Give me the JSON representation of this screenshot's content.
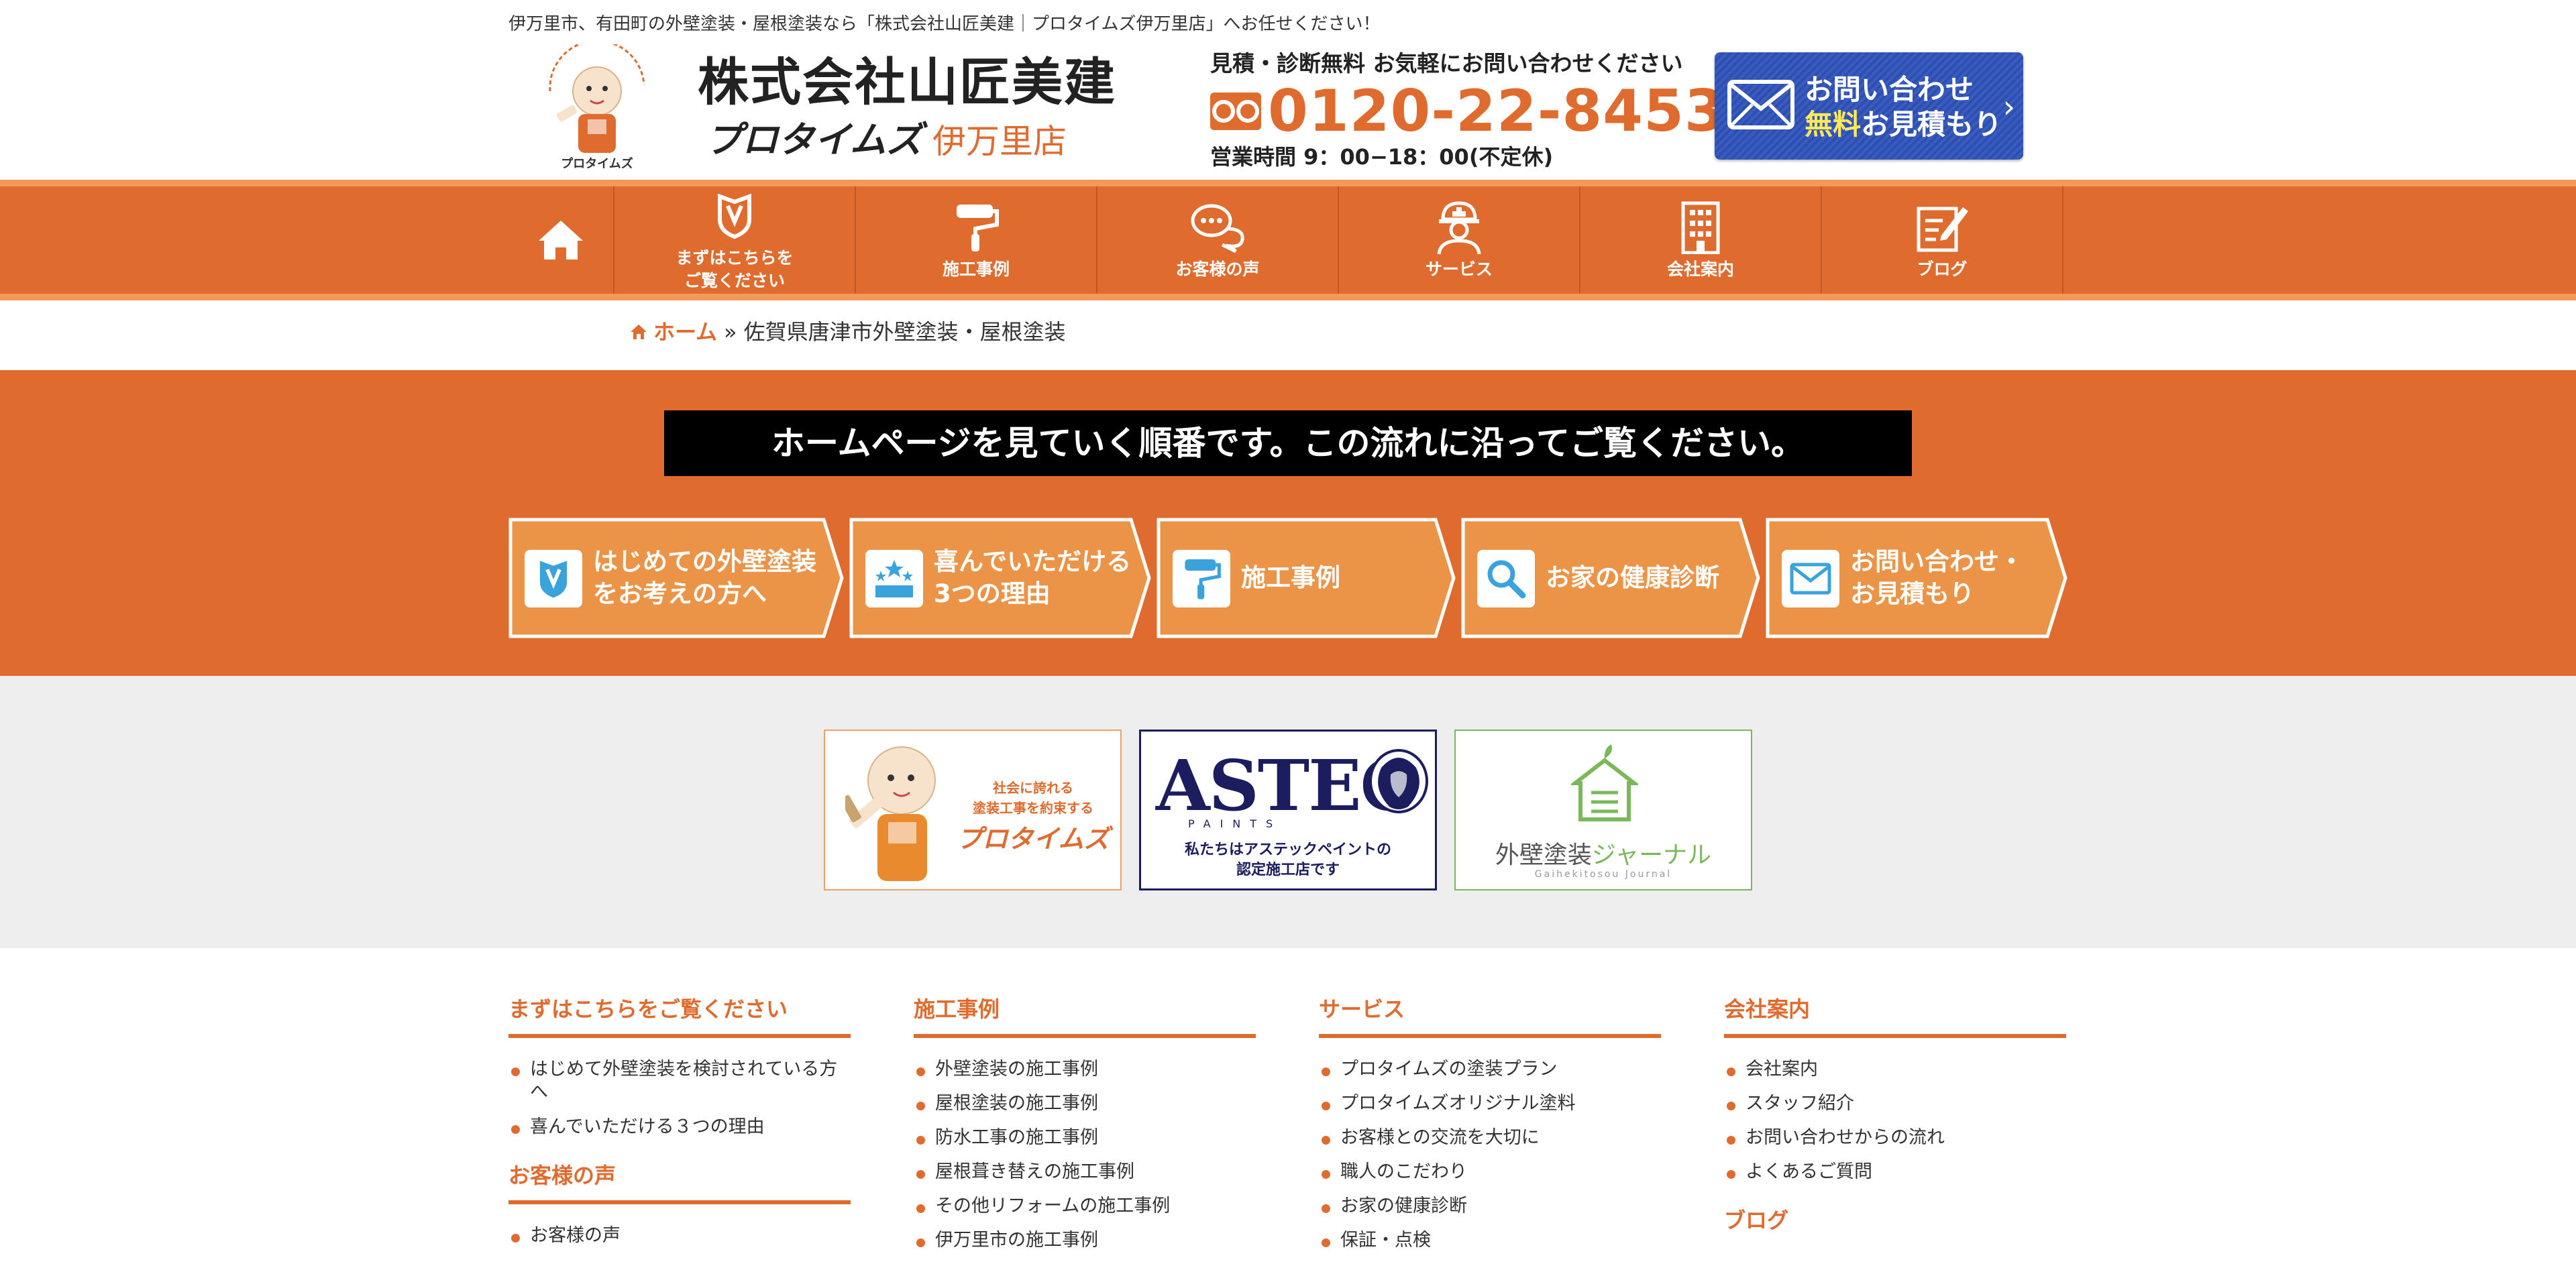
{
  "header": {
    "tagline": "伊万里市、有田町の外壁塗装・屋根塗装なら「株式会社山匠美建｜プロタイムズ伊万里店」へお任せください！",
    "company_name": "株式会社山匠美建",
    "brand": "プロタイムズ",
    "branch": "伊万里店",
    "contact_lead": "見積・診断無料 お気軽にお問い合わせください",
    "phone": "0120-22-8453",
    "hours": "営業時間 9：00−18：00(不定休)",
    "cta_line1": "お問い合わせ",
    "cta_free": "無料",
    "cta_line2": "お見積もり"
  },
  "nav": {
    "items": [
      {
        "label": "まずはこちらを\nご覧ください",
        "icon": "shield-check-icon"
      },
      {
        "label": "施工事例",
        "icon": "paint-roller-icon"
      },
      {
        "label": "お客様の声",
        "icon": "speech-bubbles-icon"
      },
      {
        "label": "サービス",
        "icon": "worker-icon"
      },
      {
        "label": "会社案内",
        "icon": "building-icon"
      },
      {
        "label": "ブログ",
        "icon": "pencil-note-icon"
      }
    ]
  },
  "breadcrumb": {
    "home": "ホーム",
    "separator": "»",
    "current": "佐賀県唐津市外壁塗装・屋根塗装"
  },
  "flow": {
    "title": "ホームページを見ていく順番です。この流れに沿ってご覧ください。",
    "steps": [
      {
        "label": "はじめての外壁塗装\nをお考えの方へ",
        "icon": "shield-check-icon"
      },
      {
        "label": "喜んでいただける\n3つの理由",
        "icon": "podium-stars-icon"
      },
      {
        "label": "施工事例",
        "icon": "paint-roller-icon"
      },
      {
        "label": "お家の健康診断",
        "icon": "magnifier-icon"
      },
      {
        "label": "お問い合わせ・\nお見積もり",
        "icon": "envelope-icon"
      }
    ]
  },
  "banners": {
    "protimes_text": "社会に誇れる\n塗装工事を約束する",
    "protimes_brand": "プロタイムズ",
    "astec_logo": "ASTEC",
    "astec_sub": "PAINTS",
    "astec_caption": "私たちはアステックペイントの\n認定施工店です",
    "journal_title_a": "外壁塗装",
    "journal_title_b": "ジャーナル",
    "journal_sub": "Gaihekitosou Journal"
  },
  "sitemap": {
    "col1_h": "まずはこちらをご覧ください",
    "col1_items": [
      "はじめて外壁塗装を検討されている方へ",
      "喜んでいただける３つの理由"
    ],
    "col1_h2": "お客様の声",
    "col1_items2": [
      "お客様の声"
    ],
    "col2_h": "施工事例",
    "col2_items": [
      "外壁塗装の施工事例",
      "屋根塗装の施工事例",
      "防水工事の施工事例",
      "屋根葺き替えの施工事例",
      "その他リフォームの施工事例",
      "伊万里市の施工事例"
    ],
    "col3_h": "サービス",
    "col3_items": [
      "プロタイムズの塗装プラン",
      "プロタイムズオリジナル塗料",
      "お客様との交流を大切に",
      "職人のこだわり",
      "お家の健康診断",
      "保証・点検"
    ],
    "col4_h": "会社案内",
    "col4_items": [
      "会社案内",
      "スタッフ紹介",
      "お問い合わせからの流れ",
      "よくあるご質問"
    ],
    "col4_h2": "ブログ"
  },
  "colors": {
    "accent": "#e06b2f",
    "accent_light": "#f29a5a",
    "step_fill": "#eb9448",
    "cta_blue": "#2d4fb0",
    "astec_navy": "#1c1d5e",
    "journal_green": "#7ab85a"
  }
}
